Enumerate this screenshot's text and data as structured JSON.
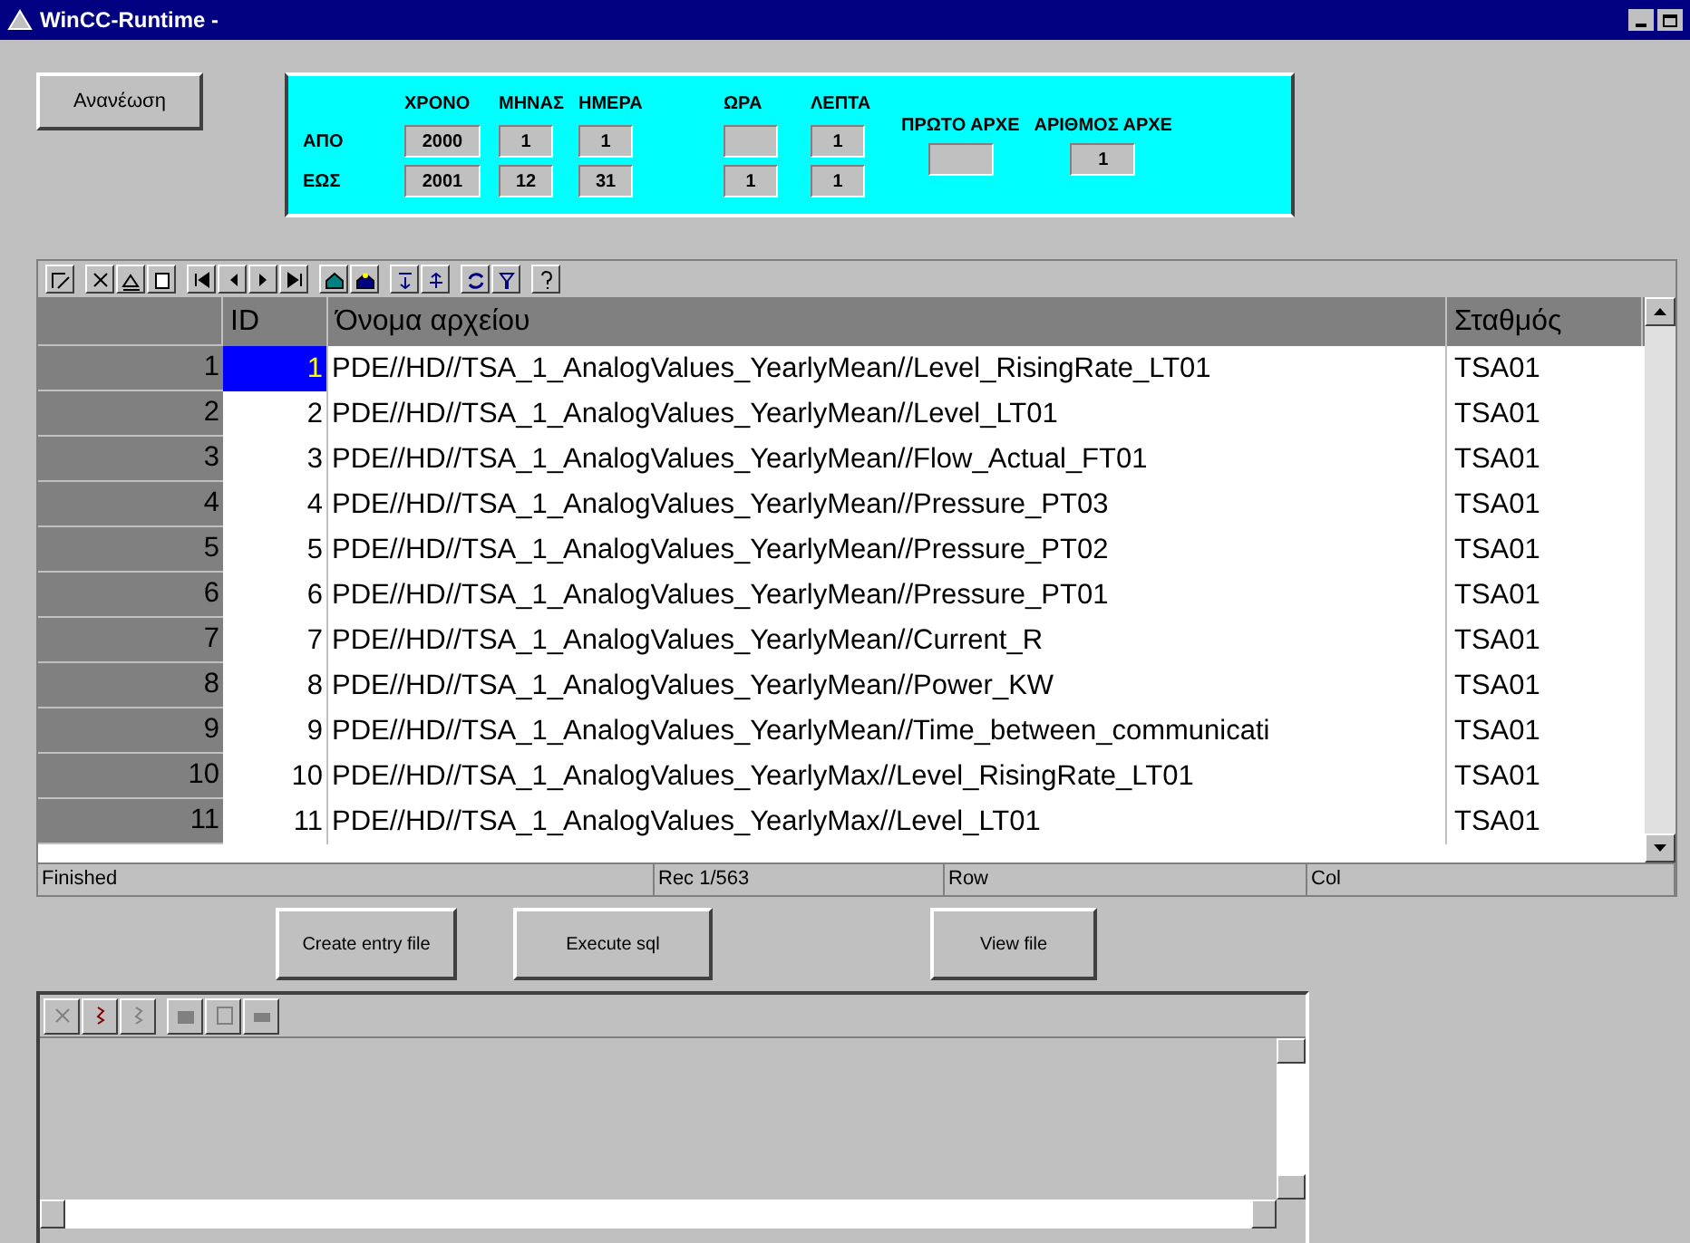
{
  "window": {
    "title": "WinCC-Runtime -"
  },
  "left_button": {
    "label": "Ανανέωση"
  },
  "filter": {
    "columns": [
      "ΧΡΟΝΟ",
      "ΜΗΝΑΣ",
      "ΗΜΕΡΑ",
      "ΩΡΑ",
      "ΛΕΠΤΑ"
    ],
    "rows": [
      {
        "label": "ΑΠΟ",
        "fields": {
          "year": "2000",
          "month": "1",
          "day": "1",
          "minute": "1"
        }
      },
      {
        "label": "ΕΩΣ",
        "fields": {
          "year": "2001",
          "month": "12",
          "day": "31",
          "hour": "1",
          "minute": "1"
        }
      }
    ],
    "first_file": {
      "label": "ΠΡΩΤΟ ΑΡΧΕ"
    },
    "file_count": {
      "label": "ΑΡΙΘΜΟΣ ΑΡΧΕ",
      "value": "1"
    }
  },
  "table": {
    "columns": [
      "ID",
      "Όνομα αρχείου",
      "Σταθμός"
    ],
    "rows": [
      {
        "row": "1",
        "id": "1",
        "name": "PDE//HD//TSA_1_AnalogValues_YearlyMean//Level_RisingRate_LT01",
        "station": "TSA01",
        "selected": true
      },
      {
        "row": "2",
        "id": "2",
        "name": "PDE//HD//TSA_1_AnalogValues_YearlyMean//Level_LT01",
        "station": "TSA01",
        "selected": false
      },
      {
        "row": "3",
        "id": "3",
        "name": "PDE//HD//TSA_1_AnalogValues_YearlyMean//Flow_Actual_FT01",
        "station": "TSA01",
        "selected": false
      },
      {
        "row": "4",
        "id": "4",
        "name": "PDE//HD//TSA_1_AnalogValues_YearlyMean//Pressure_PT03",
        "station": "TSA01",
        "selected": false
      },
      {
        "row": "5",
        "id": "5",
        "name": "PDE//HD//TSA_1_AnalogValues_YearlyMean//Pressure_PT02",
        "station": "TSA01",
        "selected": false
      },
      {
        "row": "6",
        "id": "6",
        "name": "PDE//HD//TSA_1_AnalogValues_YearlyMean//Pressure_PT01",
        "station": "TSA01",
        "selected": false
      },
      {
        "row": "7",
        "id": "7",
        "name": "PDE//HD//TSA_1_AnalogValues_YearlyMean//Current_R",
        "station": "TSA01",
        "selected": false
      },
      {
        "row": "8",
        "id": "8",
        "name": "PDE//HD//TSA_1_AnalogValues_YearlyMean//Power_KW",
        "station": "TSA01",
        "selected": false
      },
      {
        "row": "9",
        "id": "9",
        "name": "PDE//HD//TSA_1_AnalogValues_YearlyMean//Time_between_communicati",
        "station": "TSA01",
        "selected": false
      },
      {
        "row": "10",
        "id": "10",
        "name": "PDE//HD//TSA_1_AnalogValues_YearlyMax//Level_RisingRate_LT01",
        "station": "TSA01",
        "selected": false
      },
      {
        "row": "11",
        "id": "11",
        "name": "PDE//HD//TSA_1_AnalogValues_YearlyMax//Level_LT01",
        "station": "TSA01",
        "selected": false
      }
    ]
  },
  "status_bar": [
    "Finished",
    "Rec 1/563",
    "Row",
    "Col"
  ],
  "buttons": [
    "Create entry file",
    "Execute sql",
    "View file"
  ]
}
